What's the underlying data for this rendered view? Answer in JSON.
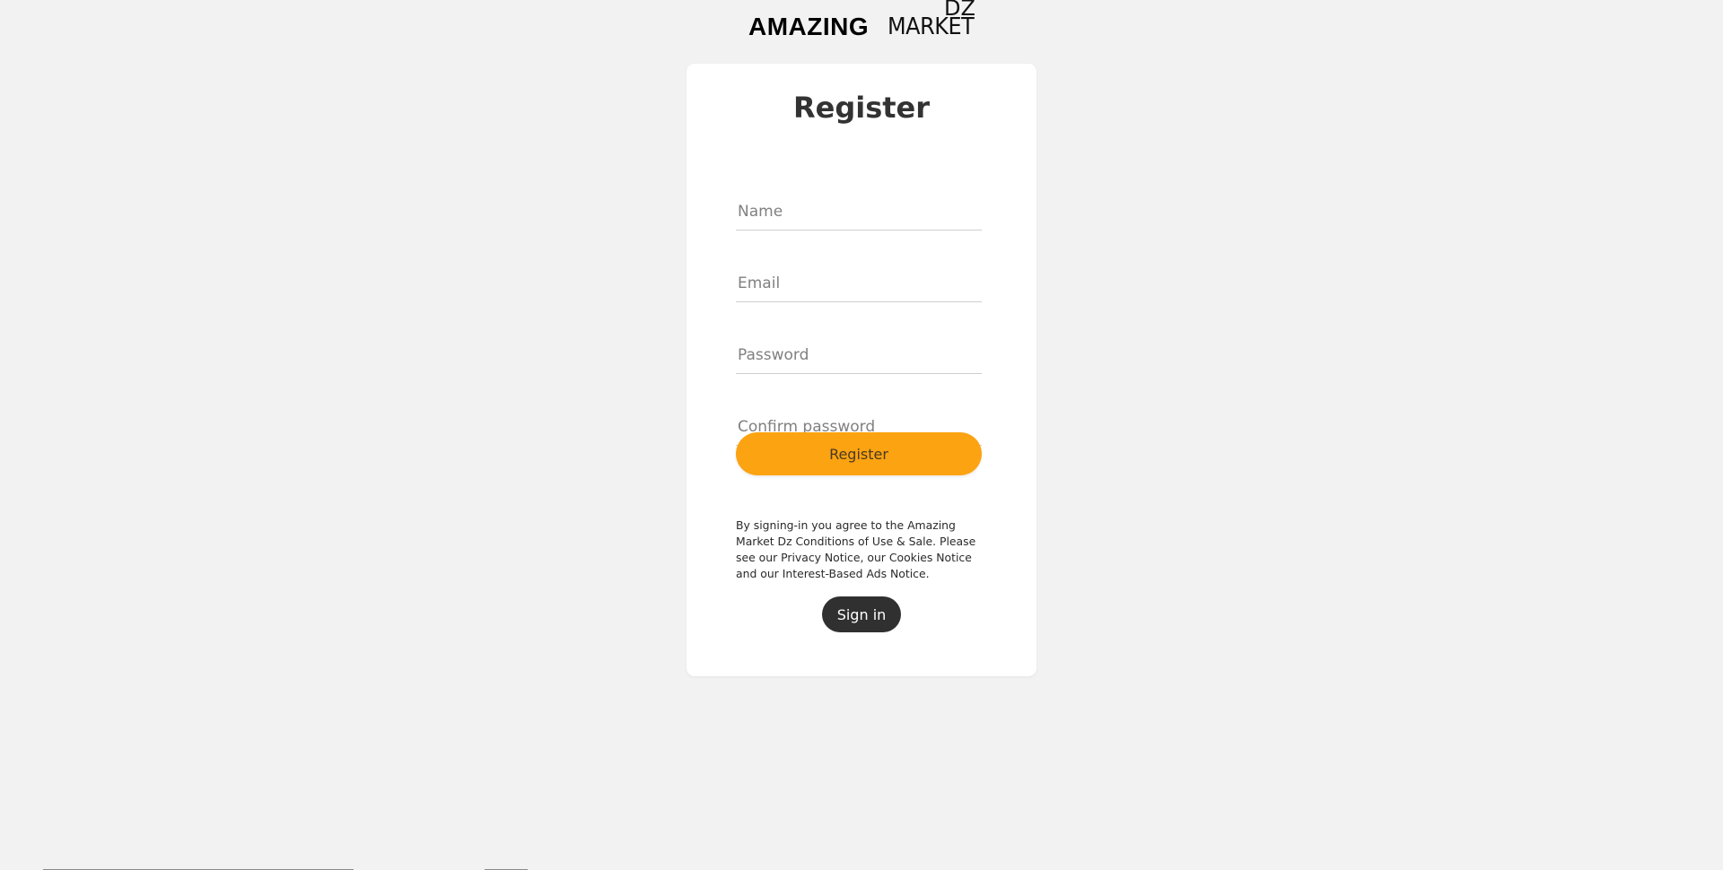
{
  "logo": {
    "bold": "AMAZING",
    "light": "MARKET",
    "superscript": "DZ"
  },
  "form": {
    "title": "Register",
    "name_placeholder": "Name",
    "email_placeholder": "Email",
    "password_placeholder": "Password",
    "confirm_placeholder": "Confirm password",
    "register_label": "Register",
    "legal_text": "By signing-in you agree to the Amazing Market Dz Conditions of Use & Sale. Please see our Privacy Notice, our Cookies Notice and our Interest-Based Ads Notice.",
    "signin_label": "Sign in"
  },
  "colors": {
    "background": "#f2f2f2",
    "card": "#ffffff",
    "accent": "#fca311",
    "signin_button": "#303030"
  }
}
